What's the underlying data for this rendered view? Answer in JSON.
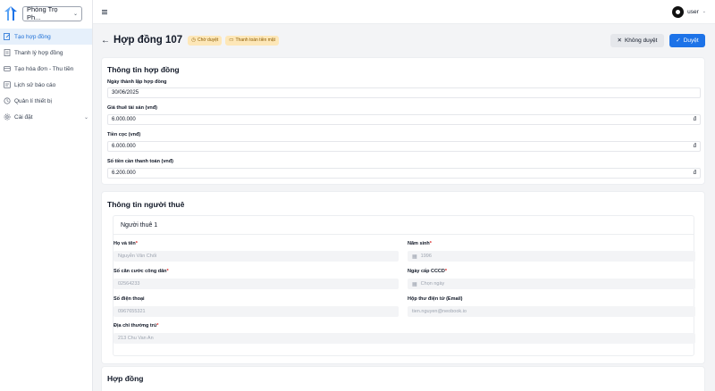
{
  "sidebar": {
    "property": "Phòng Trọ Ph...",
    "items": [
      {
        "label": "Tạo hợp đồng",
        "icon": "edit-icon",
        "active": true
      },
      {
        "label": "Thanh lý hợp đồng",
        "icon": "document-icon"
      },
      {
        "label": "Tạo hóa đơn - Thu tiền",
        "icon": "receipt-icon"
      },
      {
        "label": "Lịch sử báo cáo",
        "icon": "history-icon"
      },
      {
        "label": "Quản lí thiết bị",
        "icon": "device-icon"
      },
      {
        "label": "Cài đặt",
        "icon": "gear-icon",
        "has_submenu": true
      }
    ]
  },
  "topbar": {
    "user": "user"
  },
  "header": {
    "title": "Hợp đồng 107",
    "badges": [
      "Chờ duyệt",
      "Thanh toán tiền mặt"
    ],
    "reject_label": "Không duyệt",
    "approve_label": "Duyệt"
  },
  "contract_info": {
    "title": "Thông tin hợp đồng",
    "fields": [
      {
        "label": "Ngày thành lập hợp đồng",
        "value": "30/06/2025",
        "suffix": ""
      },
      {
        "label": "Giá thuê tài sản (vnđ)",
        "value": "6.000.000",
        "suffix": "đ"
      },
      {
        "label": "Tiền cọc (vnđ)",
        "value": "6.000.000",
        "suffix": "đ"
      },
      {
        "label": "Số tiền cần thanh toán (vnđ)",
        "value": "6.200.000",
        "suffix": "đ"
      }
    ]
  },
  "tenant_info": {
    "title": "Thông tin người thuê",
    "tenant_title": "Người thuê 1",
    "name_label": "Họ và tên",
    "name_value": "Nguyễn Văn Chối",
    "birth_label": "Năm sinh",
    "birth_value": "1996",
    "id_label": "Số căn cước công dân",
    "id_value": "02564233",
    "id_date_label": "Ngày cấp CCCD",
    "id_date_placeholder": "Chọn ngày",
    "phone_label": "Số điện thoại",
    "phone_value": "0967655321",
    "email_label": "Hộp thư điện tử (Email)",
    "email_value": "tien.nguyen@neobook.io",
    "address_label": "Địa chỉ thường trú",
    "address_value": "213 Chu Van An"
  },
  "contract_section": {
    "title": "Hợp đồng"
  },
  "colors": {
    "primary": "#1d73e8",
    "active_bg": "#e6f0fb",
    "badge_bg": "#fde7b8",
    "required": "#dc2626"
  }
}
